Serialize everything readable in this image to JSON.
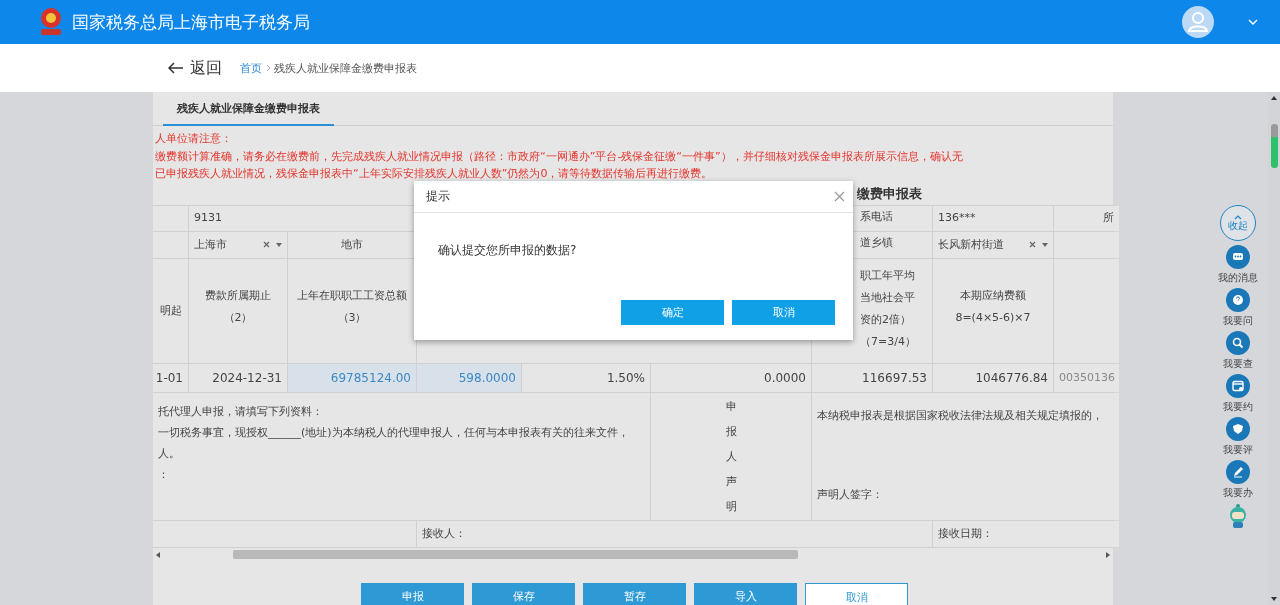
{
  "header": {
    "title": "国家税务总局上海市电子税务局"
  },
  "breadcrumb": {
    "back": "返回",
    "home": "首页",
    "current": "残疾人就业保障金缴费申报表"
  },
  "tabs": [
    {
      "label": "残疾人就业保障金缴费申报表",
      "selected": true
    }
  ],
  "notice": [
    "人单位请注意：",
    "缴费额计算准确，请务必在缴费前，先完成残疾人就业情况申报（路径：市政府“一网通办”平台-残保金征缴“一件事”），并仔细核对残保金申报表所展示信息，确认无",
    "已申报残疾人就业情况，残保金申报表中“上年实际安排残疾人就业人数”仍然为0，请等待数据传输后再进行缴费。"
  ],
  "form_title": "缴费申报表",
  "table": {
    "rows": [
      [
        {
          "kind": "blank"
        },
        {
          "kind": "value",
          "lines": [
            "9131"
          ]
        },
        {
          "kind": "merged"
        },
        {
          "kind": "merged"
        },
        {
          "kind": "merged"
        },
        {
          "kind": "merged"
        },
        {
          "kind": "partial",
          "lines": [
            "系电话"
          ]
        },
        {
          "kind": "value",
          "lines": [
            "136***"
          ]
        },
        {
          "kind": "edge",
          "lines": [
            "所"
          ]
        }
      ],
      [
        {
          "kind": "blank"
        },
        {
          "kind": "select",
          "lines": [
            "上海市"
          ]
        },
        {
          "kind": "label",
          "lines": [
            "地市"
          ]
        },
        {
          "kind": "blank"
        },
        {
          "kind": "merged"
        },
        {
          "kind": "merged"
        },
        {
          "kind": "partial",
          "lines": [
            "道乡镇"
          ]
        },
        {
          "kind": "select",
          "lines": [
            "长风新村街道"
          ]
        },
        {
          "kind": "blank"
        }
      ],
      [
        {
          "kind": "label",
          "lines": [
            "明起"
          ]
        },
        {
          "kind": "label",
          "lines": [
            "费款所属期止",
            "（2）"
          ]
        },
        {
          "kind": "label",
          "lines": [
            "上年在职职工工资总额",
            "（3）"
          ]
        },
        {
          "kind": "blank"
        },
        {
          "kind": "merged"
        },
        {
          "kind": "merged"
        },
        {
          "kind": "partial",
          "lines": [
            "职工年平均",
            "当地社会平",
            "资的2倍）",
            "（7=3/4）"
          ]
        },
        {
          "kind": "label",
          "lines": [
            "本期应纳费额",
            "8=(4×5-6)×7"
          ]
        },
        {
          "kind": "blank"
        }
      ],
      [
        {
          "kind": "number",
          "lines": [
            "1-01"
          ]
        },
        {
          "kind": "number",
          "lines": [
            "2024-12-31"
          ]
        },
        {
          "kind": "link-number",
          "lines": [
            "69785124.00"
          ]
        },
        {
          "kind": "link-number",
          "lines": [
            "598.0000"
          ]
        },
        {
          "kind": "number",
          "lines": [
            "1.50%"
          ]
        },
        {
          "kind": "number",
          "lines": [
            "0.0000"
          ]
        },
        {
          "kind": "number",
          "lines": [
            "116697.53"
          ]
        },
        {
          "kind": "number",
          "lines": [
            "1046776.84"
          ]
        },
        {
          "kind": "code",
          "lines": [
            "00350136"
          ]
        }
      ],
      [
        {
          "kind": "text",
          "lines": [
            "托代理人申报，请填写下列资料：",
            "一切税务事宜，现授权______(地址)为本纳税人的代理申报人，任何与本申报表有关的往来文件，",
            "人。",
            "："
          ]
        },
        {
          "kind": "merged"
        },
        {
          "kind": "merged"
        },
        {
          "kind": "merged"
        },
        {
          "kind": "merged"
        },
        {
          "kind": "vertical",
          "lines": [
            "申报人声明"
          ]
        },
        {
          "kind": "split",
          "lines": [
            "本纳税申报表是根据国家税收法律法规及相关规定填报的，",
            "声明人签字："
          ]
        },
        {
          "kind": "merged"
        },
        {
          "kind": "merged"
        }
      ],
      [
        {
          "kind": "blank"
        },
        {
          "kind": "merged"
        },
        {
          "kind": "merged"
        },
        {
          "kind": "value",
          "lines": [
            "接收人："
          ]
        },
        {
          "kind": "merged"
        },
        {
          "kind": "merged"
        },
        {
          "kind": "merged"
        },
        {
          "kind": "value",
          "lines": [
            "接收日期："
          ]
        },
        {
          "kind": "merged"
        }
      ]
    ]
  },
  "actions": [
    {
      "label": "申报",
      "kind": "primary"
    },
    {
      "label": "保存",
      "kind": "primary"
    },
    {
      "label": "暂存",
      "kind": "primary"
    },
    {
      "label": "导入",
      "kind": "primary"
    },
    {
      "label": "取消",
      "kind": "outline"
    }
  ],
  "dialog": {
    "title": "提示",
    "message": "确认提交您所申报的数据?",
    "buttons": [
      {
        "label": "确定"
      },
      {
        "label": "取消"
      }
    ]
  },
  "sidebar": {
    "collapse": "收起",
    "items": [
      {
        "label": "我的消息",
        "kind": "chat"
      },
      {
        "label": "我要问",
        "kind": "help"
      },
      {
        "label": "我要查",
        "kind": "search"
      },
      {
        "label": "我要约",
        "kind": "calendar"
      },
      {
        "label": "我要评",
        "kind": "rate"
      },
      {
        "label": "我要办",
        "kind": "edit"
      }
    ]
  }
}
